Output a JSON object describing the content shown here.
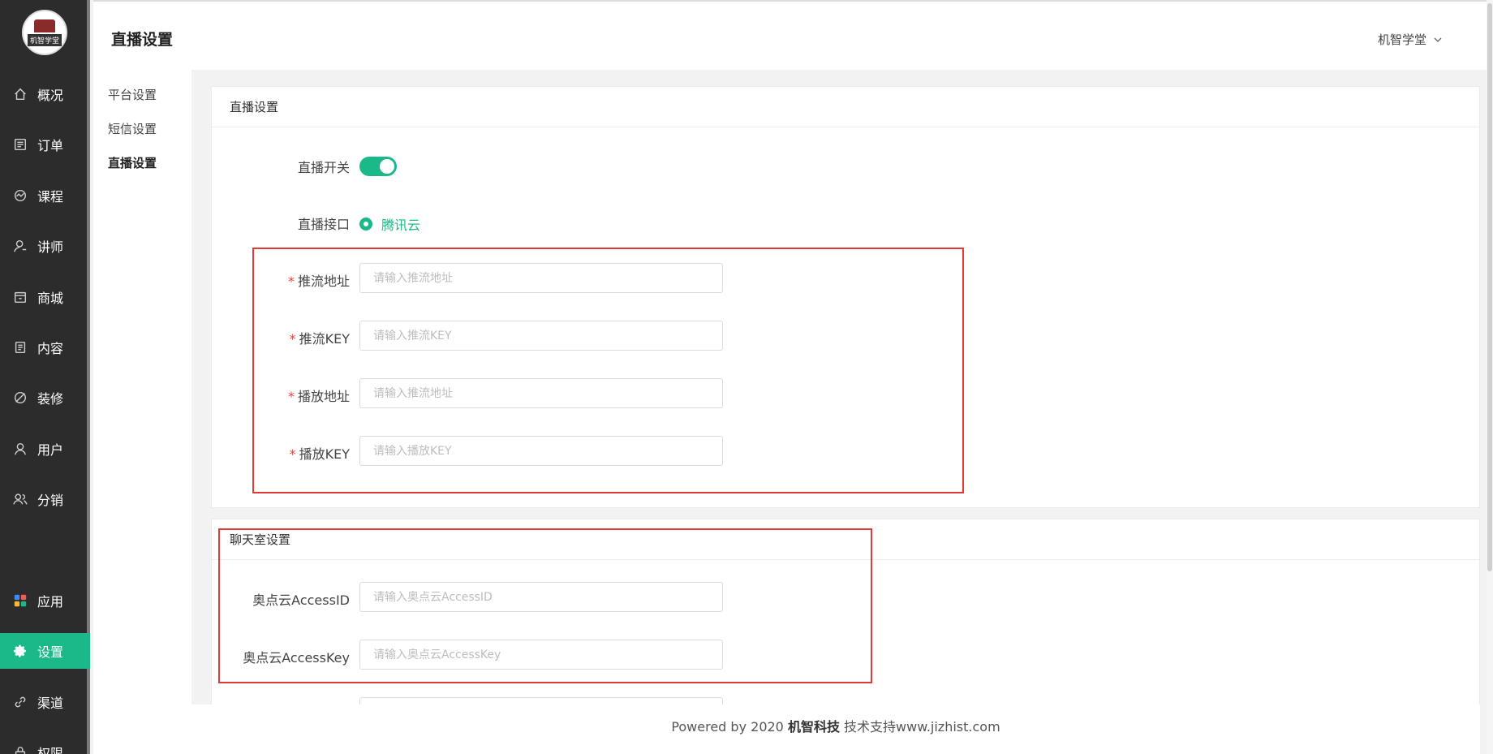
{
  "app": {
    "logo_text": "机智学堂",
    "page_title": "直播设置",
    "user_name": "机智学堂"
  },
  "sidebar": {
    "items": [
      {
        "label": "概况",
        "icon": "home-icon"
      },
      {
        "label": "订单",
        "icon": "order-icon"
      },
      {
        "label": "课程",
        "icon": "course-icon"
      },
      {
        "label": "讲师",
        "icon": "teacher-icon"
      },
      {
        "label": "商城",
        "icon": "store-icon"
      },
      {
        "label": "内容",
        "icon": "content-icon"
      },
      {
        "label": "装修",
        "icon": "decorate-icon"
      },
      {
        "label": "用户",
        "icon": "user-icon"
      },
      {
        "label": "分销",
        "icon": "distribution-icon"
      },
      {
        "label": "应用",
        "icon": "apps-icon"
      },
      {
        "label": "设置",
        "icon": "gear-icon",
        "active": true
      },
      {
        "label": "渠道",
        "icon": "link-icon"
      },
      {
        "label": "权限",
        "icon": "permission-icon"
      }
    ],
    "active_color": "#1bb98a"
  },
  "subnav": {
    "items": [
      "平台设置",
      "短信设置",
      "直播设置"
    ],
    "active": "直播设置"
  },
  "live_card": {
    "title": "直播设置",
    "switch_label": "直播开关",
    "switch_on": true,
    "interface_label": "直播接口",
    "interface_option": "腾讯云",
    "push_url_label": "推流地址",
    "push_url_placeholder": "请输入推流地址",
    "push_key_label": "推流KEY",
    "push_key_placeholder": "请输入推流KEY",
    "play_url_label": "播放地址",
    "play_url_placeholder": "请输入推流地址",
    "play_key_label": "播放KEY",
    "play_key_placeholder": "请输入播放KEY"
  },
  "chat_card": {
    "title": "聊天室设置",
    "access_id_label": "奥点云AccessID",
    "access_id_placeholder": "请输入奥点云AccessID",
    "access_key_label": "奥点云AccessKey",
    "access_key_placeholder": "请输入奥点云AccessKey"
  },
  "footer": {
    "prefix": "Powered by 2020 ",
    "company": "机智科技",
    "suffix": " 技术支持www.jizhist.com"
  },
  "colors": {
    "accent": "#1bb98a",
    "required": "#e3423c",
    "highlight_box": "#e53935"
  }
}
